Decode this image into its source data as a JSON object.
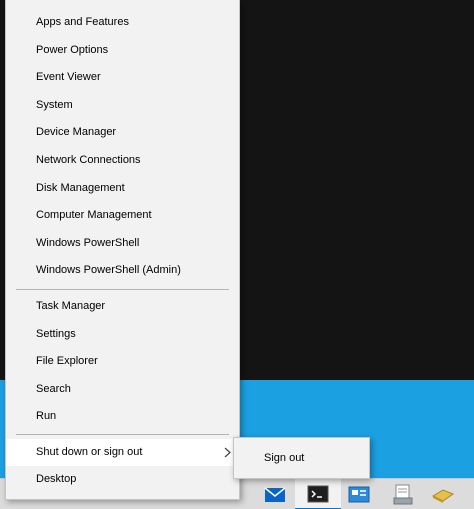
{
  "menu": {
    "items": [
      {
        "label": "Apps and Features"
      },
      {
        "label": "Power Options"
      },
      {
        "label": "Event Viewer"
      },
      {
        "label": "System"
      },
      {
        "label": "Device Manager"
      },
      {
        "label": "Network Connections"
      },
      {
        "label": "Disk Management"
      },
      {
        "label": "Computer Management"
      },
      {
        "label": "Windows PowerShell"
      },
      {
        "label": "Windows PowerShell (Admin)"
      },
      {
        "label": "Task Manager"
      },
      {
        "label": "Settings"
      },
      {
        "label": "File Explorer"
      },
      {
        "label": "Search"
      },
      {
        "label": "Run"
      },
      {
        "label": "Shut down or sign out"
      },
      {
        "label": "Desktop"
      }
    ]
  },
  "submenu": {
    "items": [
      {
        "label": "Sign out"
      }
    ]
  },
  "taskbar": {
    "icons": [
      "mail-icon",
      "terminal-icon",
      "control-panel-icon",
      "document-icon",
      "folder-note-icon"
    ]
  },
  "colors": {
    "menu_bg": "#f2f2f2",
    "wallpaper_blue": "#1ba1e2",
    "accent": "#0078d7"
  }
}
